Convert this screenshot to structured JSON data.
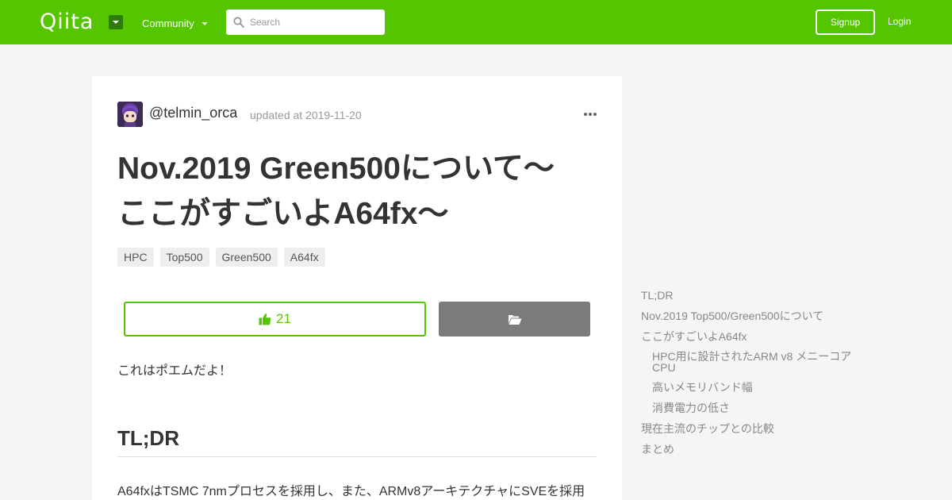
{
  "header": {
    "logo": "Qiita",
    "community_label": "Community",
    "search_placeholder": "Search",
    "signup_label": "Signup",
    "login_label": "Login",
    "brand_color": "#55c500"
  },
  "article": {
    "author": "@telmin_orca",
    "updated": "updated at 2019-11-20",
    "title_line1": "Nov.2019 Green500について～",
    "title_line2": "ここがすごいよA64fx～",
    "tags": [
      "HPC",
      "Top500",
      "Green500",
      "A64fx"
    ],
    "like_count": "21",
    "intro": "これはポエムだよ！",
    "section_heading": "TL;DR",
    "paragraph": "A64fxはTSMC 7nmプロセスを採用し、また、ARMv8アーキテクチャにSVEを採用"
  },
  "toc": {
    "items": [
      "TL;DR",
      "Nov.2019 Top500/Green500について",
      "ここがすごいよA64fx",
      "HPC用に設計されたARM v8 メニーコアCPU",
      "高いメモリバンド幅",
      "消費電力の低さ",
      "現在主流のチップとの比較",
      "まとめ"
    ]
  }
}
